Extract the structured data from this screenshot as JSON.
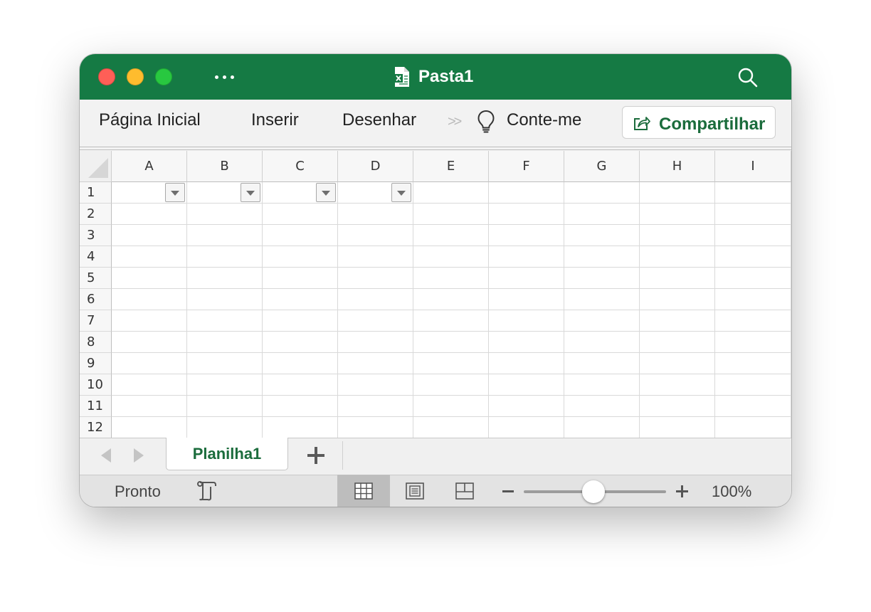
{
  "window": {
    "title": "Pasta1"
  },
  "titlebar": {
    "icons": [
      "close-button",
      "minimize-button",
      "zoom-button",
      "more-icon",
      "excel-doc-icon",
      "search-icon"
    ]
  },
  "ribbon": {
    "tabs": [
      {
        "label": "Página Inicial"
      },
      {
        "label": "Inserir"
      },
      {
        "label": "Desenhar"
      }
    ],
    "overflow_icon": "chevron-double-right-icon",
    "tell_me": "Conte-me",
    "share_label": "Compartilhar"
  },
  "sheet": {
    "columns": [
      "A",
      "B",
      "C",
      "D",
      "E",
      "F",
      "G",
      "H",
      "I"
    ],
    "rows": [
      "1",
      "2",
      "3",
      "4",
      "5",
      "6",
      "7",
      "8",
      "9",
      "10",
      "11",
      "12"
    ],
    "filter_columns": [
      "A",
      "B",
      "C",
      "D"
    ]
  },
  "sheet_tabs": {
    "active": "Planilha1"
  },
  "statusbar": {
    "status": "Pronto",
    "zoom": "100%",
    "zoom_fraction": 0.5,
    "active_view": "normal-view"
  },
  "colors": {
    "title_bar": "#157a44",
    "accent_text": "#1b6c3c"
  }
}
